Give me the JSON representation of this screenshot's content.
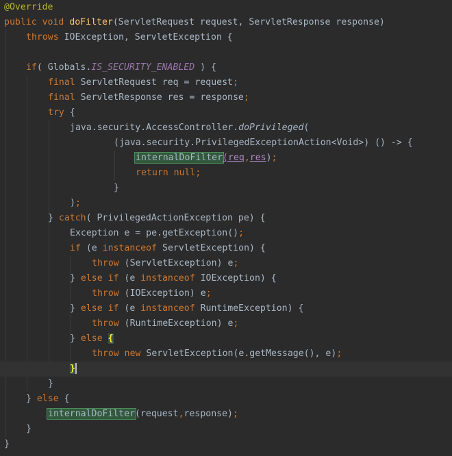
{
  "code": {
    "l1": {
      "annotation": "@Override"
    },
    "l2": {
      "kw1": "public",
      "kw2": "void",
      "fn": "doFilter",
      "rest": "(ServletRequest request, ServletResponse response)"
    },
    "l3": {
      "kw": "throws",
      "rest": " IOException, ServletException {"
    },
    "l5": {
      "kw": "if",
      "a": "( Globals.",
      "static": "IS_SECURITY_ENABLED",
      "b": " ) {"
    },
    "l6": {
      "kw": "final",
      "rest": " ServletRequest req = request",
      "semi": ";"
    },
    "l7": {
      "kw": "final",
      "rest": " ServletResponse res = response",
      "semi": ";"
    },
    "l8": {
      "kw": "try",
      "rest": " {"
    },
    "l9": {
      "a": "java.security.AccessController.",
      "method": "doPrivileged",
      "b": "("
    },
    "l10": {
      "text": "(java.security.PrivilegedExceptionAction<Void>) () -> {"
    },
    "l11": {
      "method": "internalDoFilter",
      "p1": "req",
      "comma": ",",
      "p2": "res",
      "end": ")",
      "semi": ";"
    },
    "l12": {
      "kw": "return",
      "kw2": "null",
      "semi": ";"
    },
    "l13": {
      "text": "}"
    },
    "l14": {
      "text": ")",
      "semi": ";"
    },
    "l15": {
      "a": "} ",
      "kw": "catch",
      "b": "( PrivilegedActionException pe) {"
    },
    "l16": {
      "text": "Exception e = pe.getException()",
      "semi": ";"
    },
    "l17": {
      "kw": "if",
      "a": " (e ",
      "kw2": "instanceof",
      "b": " ServletException) {"
    },
    "l18": {
      "kw": "throw",
      "rest": " (ServletException) e",
      "semi": ";"
    },
    "l19": {
      "a": "} ",
      "kw": "else if",
      "b": " (e ",
      "kw2": "instanceof",
      "c": " IOException) {"
    },
    "l20": {
      "kw": "throw",
      "rest": " (IOException) e",
      "semi": ";"
    },
    "l21": {
      "a": "} ",
      "kw": "else if",
      "b": " (e ",
      "kw2": "instanceof",
      "c": " RuntimeException) {"
    },
    "l22": {
      "kw": "throw",
      "rest": " (RuntimeException) e",
      "semi": ";"
    },
    "l23": {
      "a": "} ",
      "kw": "else",
      "b": " ",
      "brace": "{"
    },
    "l24": {
      "kw": "throw",
      "kw2": "new",
      "rest": " ServletException(e.getMessage(), e)",
      "semi": ";"
    },
    "l25": {
      "brace": "}"
    },
    "l26": {
      "text": "}"
    },
    "l27": {
      "a": "} ",
      "kw": "else",
      "b": " {"
    },
    "l28": {
      "method": "internalDoFilter",
      "rest": "(request",
      "comma": ",",
      "rest2": "response)",
      "semi": ";"
    },
    "l29": {
      "text": "}"
    },
    "l30": {
      "text": "}"
    }
  },
  "colors": {
    "background": "#2b2b2b",
    "default": "#a9b7c6",
    "keyword": "#cc7832",
    "annotation": "#bbb529",
    "function": "#ffc66d",
    "static_field": "#9876aa",
    "param": "#b389c5",
    "usage_highlight": "#32593d",
    "caret_line": "#323232"
  }
}
